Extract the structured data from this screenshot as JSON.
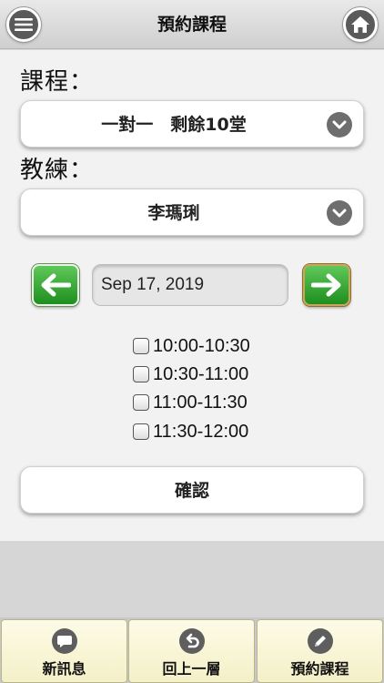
{
  "header": {
    "title": "預約課程",
    "menu_icon": "menu-icon",
    "home_icon": "home-icon"
  },
  "course": {
    "label": "課程：",
    "selected": "一對一　剩餘10堂"
  },
  "coach": {
    "label": "教練：",
    "selected": "李瑪琍"
  },
  "date": {
    "value": "Sep 17, 2019"
  },
  "time_slots": [
    {
      "label": "10:00-10:30",
      "checked": false
    },
    {
      "label": "10:30-11:00",
      "checked": false
    },
    {
      "label": "11:00-11:30",
      "checked": false
    },
    {
      "label": "11:30-12:00",
      "checked": false
    }
  ],
  "confirm_label": "確認",
  "tabs": [
    {
      "label": "新訊息",
      "icon": "message-icon"
    },
    {
      "label": "回上一層",
      "icon": "back-icon"
    },
    {
      "label": "預約課程",
      "icon": "pencil-icon"
    }
  ],
  "colors": {
    "arrow_green": "#1e8f1f",
    "tab_bg": "#f4f0c8",
    "icon_gray": "#5e5e5e"
  }
}
